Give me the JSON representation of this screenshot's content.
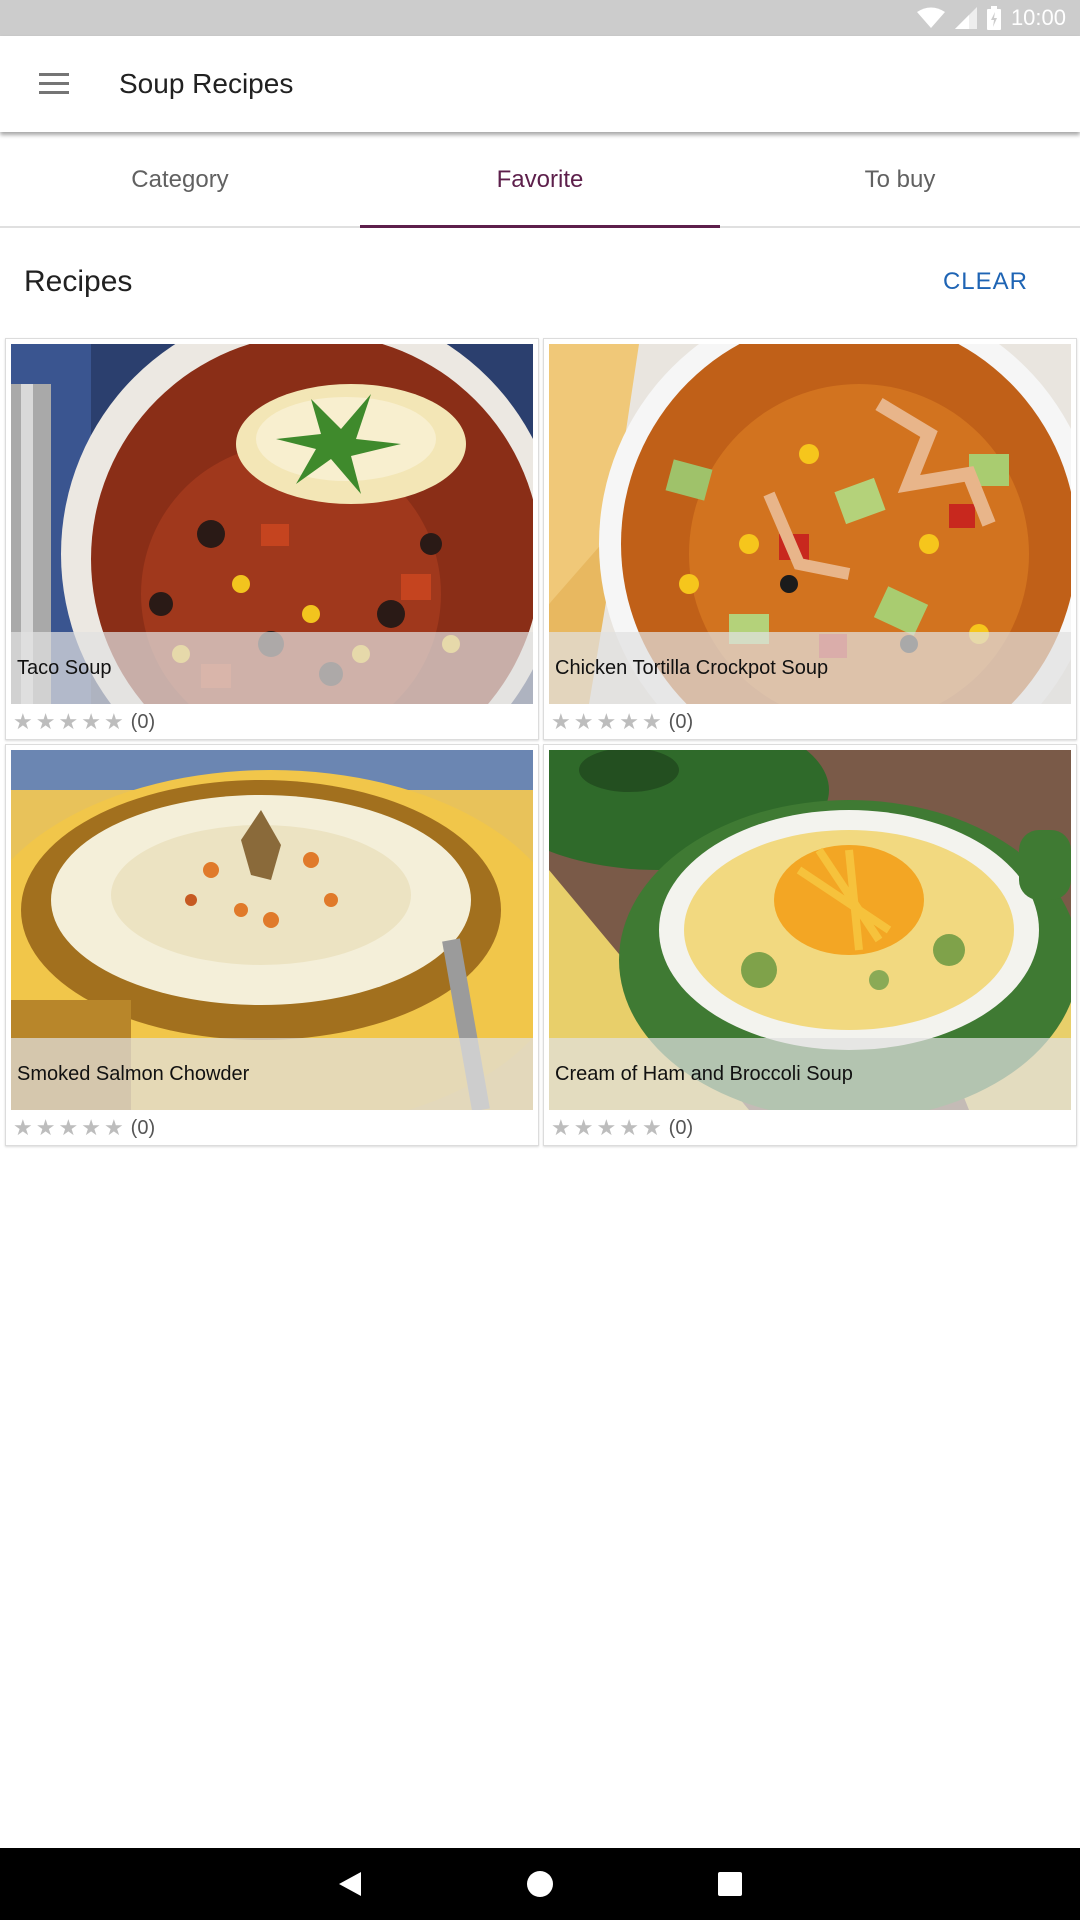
{
  "status_bar": {
    "time": "10:00"
  },
  "app_bar": {
    "title": "Soup Recipes"
  },
  "tabs": [
    {
      "label": "Category",
      "active": false
    },
    {
      "label": "Favorite",
      "active": true
    },
    {
      "label": "To buy",
      "active": false
    }
  ],
  "section": {
    "title": "Recipes",
    "clear_label": "CLEAR"
  },
  "recipes": [
    {
      "name": "Taco Soup",
      "rating_count": "(0)",
      "stars": 0
    },
    {
      "name": "Chicken Tortilla Crockpot Soup",
      "rating_count": "(0)",
      "stars": 0
    },
    {
      "name": "Smoked Salmon Chowder",
      "rating_count": "(0)",
      "stars": 0
    },
    {
      "name": "Cream of Ham and Broccoli Soup",
      "rating_count": "(0)",
      "stars": 0
    }
  ],
  "colors": {
    "accent": "#5d1f4b",
    "clear_button": "#1e64b4",
    "status_bar": "#cccccc",
    "nav_bar": "#000000"
  },
  "icons": {
    "menu": "hamburger-menu-icon",
    "wifi": "wifi-icon",
    "signal": "signal-icon",
    "battery": "battery-icon",
    "back": "back-icon",
    "home": "home-icon",
    "recents": "recents-icon",
    "star": "star-icon"
  }
}
